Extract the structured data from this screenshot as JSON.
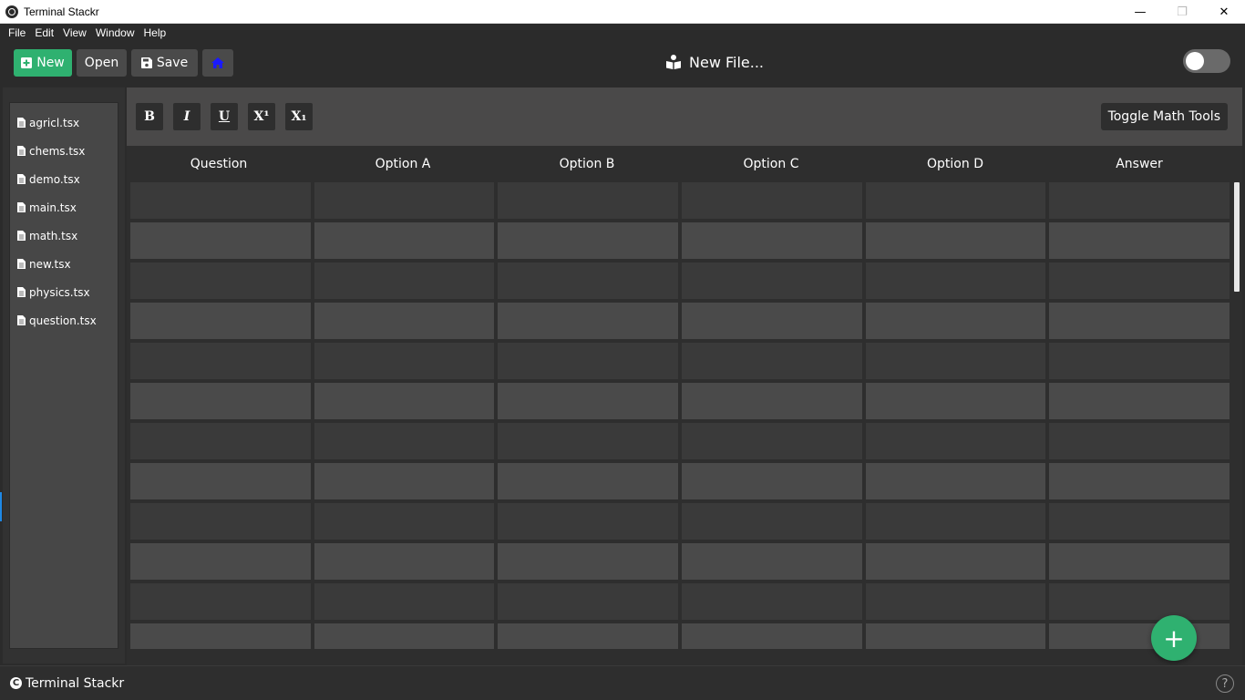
{
  "window": {
    "title": "Terminal Stackr",
    "minimize_glyph": "—",
    "restore_glyph": "❐",
    "close_glyph": "✕"
  },
  "menu": [
    "File",
    "Edit",
    "View",
    "Window",
    "Help"
  ],
  "toolbar": {
    "new_label": "New",
    "open_label": "Open",
    "save_label": "Save",
    "document_title": "New File...",
    "dark_mode_on": false
  },
  "sidebar": {
    "files": [
      "agricl.tsx",
      "chems.tsx",
      "demo.tsx",
      "main.tsx",
      "math.tsx",
      "new.tsx",
      "physics.tsx",
      "question.tsx"
    ]
  },
  "format_bar": {
    "bold": "B",
    "italic": "I",
    "underline": "U",
    "superscript": "X¹",
    "subscript": "X₁",
    "math_tools_label": "Toggle Math Tools"
  },
  "grid": {
    "columns": [
      "Question",
      "Option A",
      "Option B",
      "Option C",
      "Option D",
      "Answer"
    ],
    "row_count": 12
  },
  "fab": {
    "glyph": "+"
  },
  "status": {
    "app_name": "Terminal Stackr",
    "copyright_glyph": "C",
    "help_glyph": "?"
  },
  "colors": {
    "accent_green": "#2fb170",
    "home_icon_blue": "#1a1aff"
  }
}
